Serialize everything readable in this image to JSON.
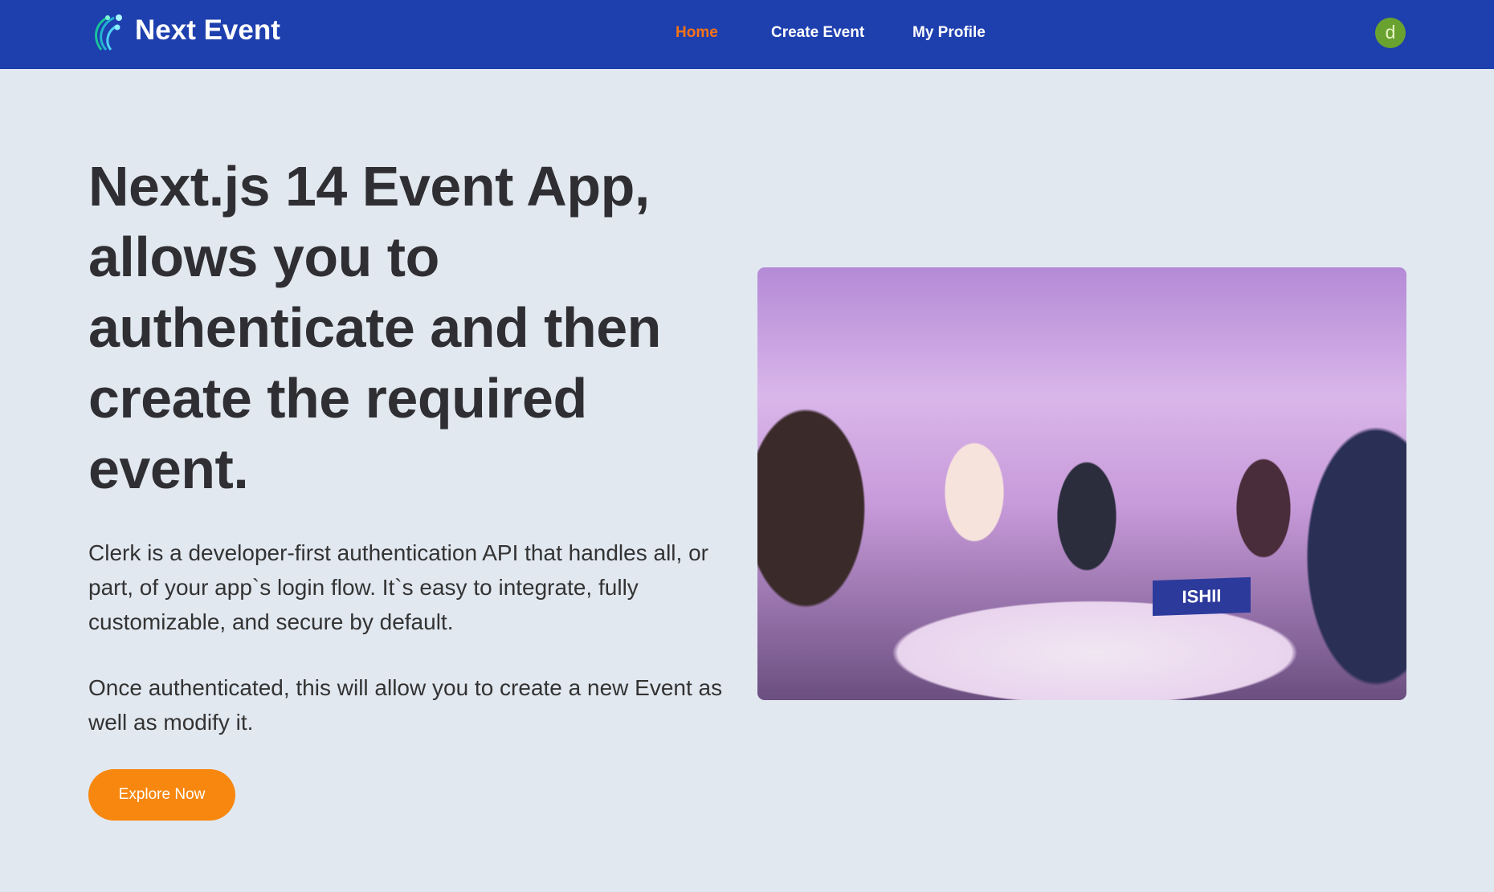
{
  "navbar": {
    "brand": "Next Event",
    "links": [
      {
        "label": "Home",
        "active": true
      },
      {
        "label": "Create Event",
        "active": false
      },
      {
        "label": "My Profile",
        "active": false
      }
    ],
    "avatar_initial": "d"
  },
  "hero": {
    "title": "Next.js 14 Event App, allows you to authenticate and then create the required event.",
    "paragraph1": "Clerk is a developer-first authentication API that handles all, or part, of your app`s login flow. It`s easy to integrate, fully customizable, and secure by default.",
    "paragraph2": "Once authenticated, this will allow you to create a new Event as well as modify it.",
    "cta_label": "Explore Now",
    "image_sign_text": "ISHII"
  },
  "colors": {
    "navbar": "#1e3fae",
    "accent": "#f7870f",
    "active_link": "#f97316",
    "background": "#e2e8f0"
  }
}
